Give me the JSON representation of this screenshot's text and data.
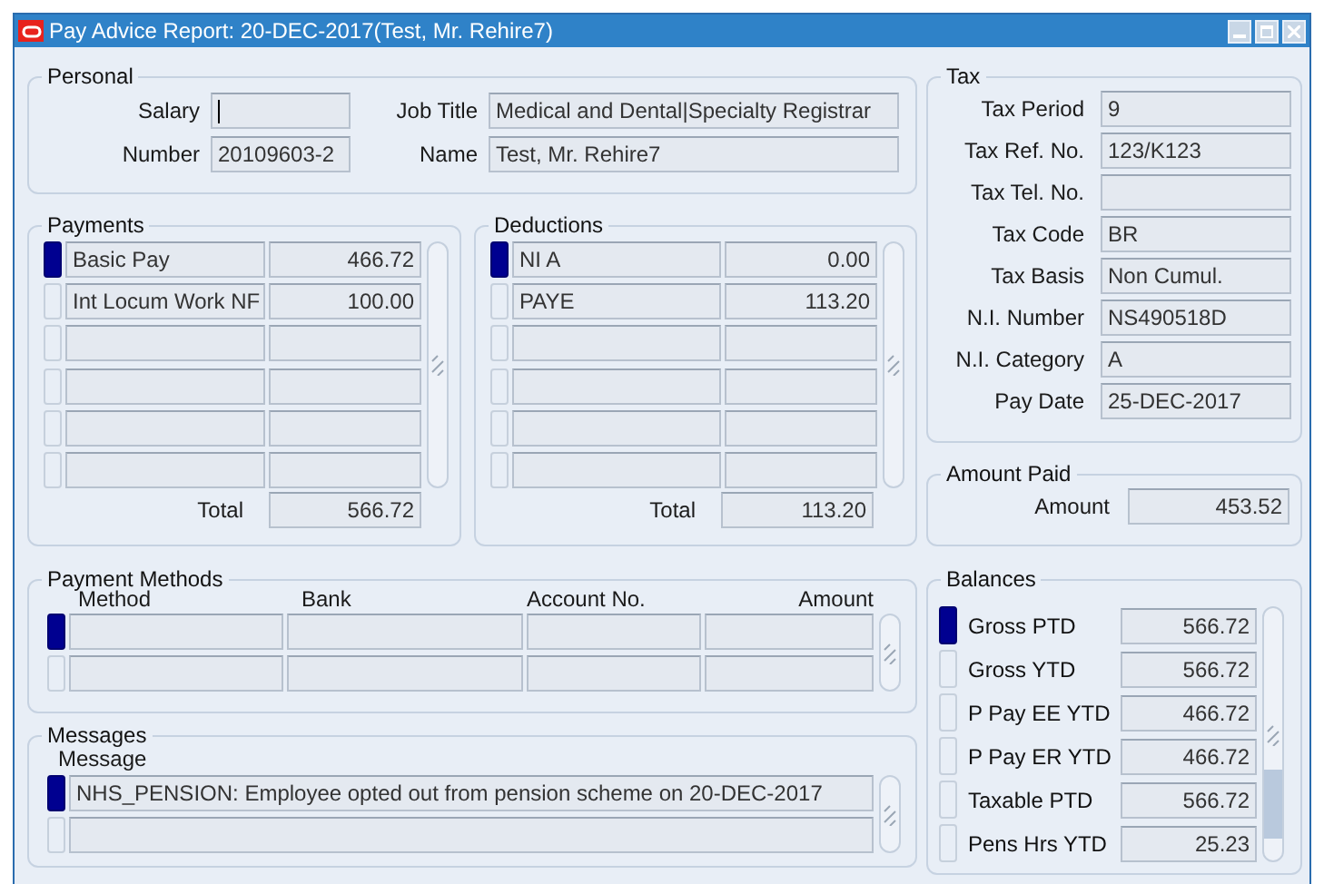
{
  "window": {
    "title": "Pay Advice Report: 20-DEC-2017(Test, Mr. Rehire7)"
  },
  "personal": {
    "title": "Personal",
    "fields": [
      {
        "label": "Salary",
        "focused": true
      },
      {
        "label": "Job Title",
        "value": "Medical and Dental|Specialty Registrar",
        "focused": false
      },
      {
        "label": "Number",
        "value": "20109603-2",
        "focused": false
      },
      {
        "label": "Name",
        "value": "Test, Mr. Rehire7",
        "focused": false
      }
    ]
  },
  "payments": {
    "title": "Payments",
    "rows": [
      {
        "name": "Basic Pay",
        "amount": "466.72",
        "selected": true
      },
      {
        "name": "Int Locum Work NF",
        "amount": "100.00",
        "selected": false
      },
      {
        "selected": false
      },
      {
        "selected": false
      },
      {
        "selected": false
      },
      {
        "selected": false
      }
    ],
    "total_label": "Total",
    "total": "566.72"
  },
  "deductions": {
    "title": "Deductions",
    "rows": [
      {
        "name": "NI A",
        "amount": "0.00",
        "selected": true
      },
      {
        "name": "PAYE",
        "amount": "113.20",
        "selected": false
      },
      {
        "selected": false
      },
      {
        "selected": false
      },
      {
        "selected": false
      },
      {
        "selected": false
      }
    ],
    "total_label": "Total",
    "total": "113.20"
  },
  "tax": {
    "title": "Tax",
    "fields": [
      {
        "label": "Tax Period",
        "value": "9"
      },
      {
        "label": "Tax Ref. No.",
        "value": "123/K123"
      },
      {
        "label": "Tax Tel. No."
      },
      {
        "label": "Tax Code",
        "value": "BR"
      },
      {
        "label": "Tax Basis",
        "value": "Non Cumul."
      },
      {
        "label": "N.I. Number",
        "value": "NS490518D"
      },
      {
        "label": "N.I. Category",
        "value": "A"
      },
      {
        "label": "Pay Date",
        "value": "25-DEC-2017"
      }
    ]
  },
  "amount_paid": {
    "title": "Amount Paid",
    "label": "Amount",
    "value": "453.52"
  },
  "payment_methods": {
    "title": "Payment Methods",
    "columns": [
      "Method",
      "Bank",
      "Account No.",
      "Amount"
    ],
    "rows": [
      {
        "selected": true
      },
      {
        "selected": false
      }
    ]
  },
  "messages": {
    "title": "Messages",
    "columns": [
      "Message"
    ],
    "rows": [
      {
        "text": "NHS_PENSION: Employee opted out from pension scheme on 20-DEC-2017",
        "selected": true
      },
      {
        "selected": false
      }
    ]
  },
  "balances": {
    "title": "Balances",
    "rows": [
      {
        "label": "Gross PTD",
        "value": "566.72",
        "selected": true
      },
      {
        "label": "Gross YTD",
        "value": "566.72",
        "selected": false
      },
      {
        "label": "P Pay EE YTD",
        "value": "466.72",
        "selected": false
      },
      {
        "label": "P Pay ER YTD",
        "value": "466.72",
        "selected": false
      },
      {
        "label": "Taxable PTD",
        "value": "566.72",
        "selected": false
      },
      {
        "label": "Pens Hrs YTD",
        "value": "25.23",
        "selected": false
      }
    ]
  }
}
